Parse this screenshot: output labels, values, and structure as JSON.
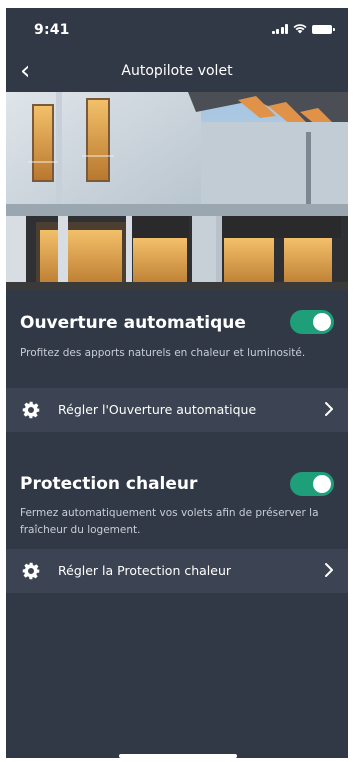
{
  "status_bar": {
    "time": "9:41"
  },
  "nav": {
    "title": "Autopilote volet"
  },
  "sections": [
    {
      "title": "Ouverture automatique",
      "description": "Profitez des apports naturels en chaleur et luminosité.",
      "enabled": true,
      "settings_label": "Régler l'Ouverture automatique"
    },
    {
      "title": "Protection chaleur",
      "description": "Fermez automatiquement vos volets afin de préserver la fraîcheur du logement.",
      "enabled": true,
      "settings_label": "Régler la Protection chaleur"
    }
  ],
  "colors": {
    "background": "#313947",
    "row": "#3c4453",
    "toggle_on": "#1e9e79"
  }
}
